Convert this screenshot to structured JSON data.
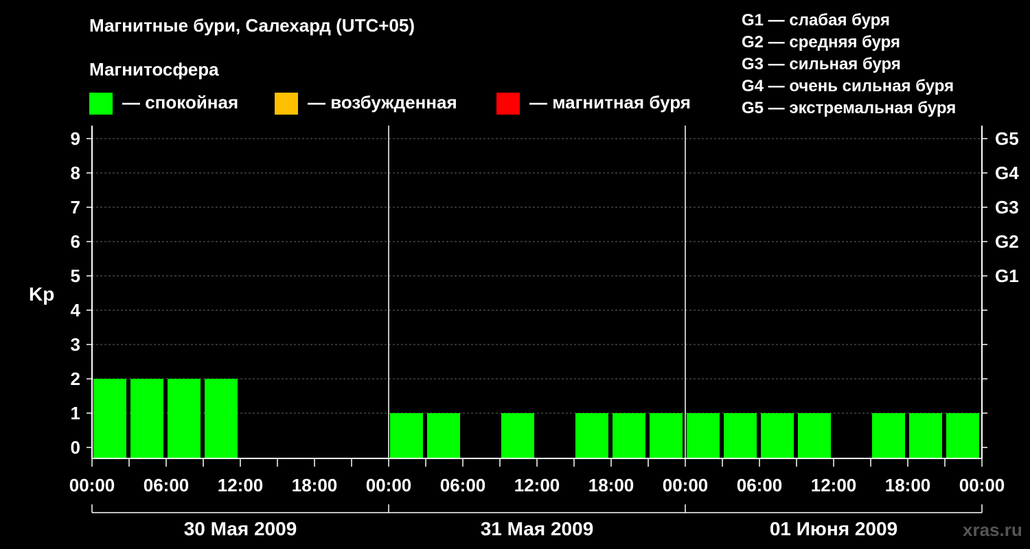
{
  "header": {
    "title": "Магнитные бури, Салехард (UTC+05)",
    "subtitle": "Магнитосфера"
  },
  "legend": [
    {
      "label": "— спокойная",
      "color": "#00ff00"
    },
    {
      "label": "— возбужденная",
      "color": "#ffc000"
    },
    {
      "label": "— магнитная буря",
      "color": "#ff0000"
    }
  ],
  "storm_scale": [
    "G1 — слабая буря",
    "G2 — средняя буря",
    "G3 — сильная буря",
    "G4 — очень сильная буря",
    "G5 — экстремальная буря"
  ],
  "watermark": "xras.ru",
  "chart_data": {
    "type": "bar",
    "ylabel": "Kp",
    "ylim": [
      0,
      9
    ],
    "y_ticks": [
      "0",
      "1",
      "2",
      "3",
      "4",
      "5",
      "6",
      "7",
      "8",
      "9"
    ],
    "right_axis_labels": [
      {
        "value": 5,
        "label": "G1"
      },
      {
        "value": 6,
        "label": "G2"
      },
      {
        "value": 7,
        "label": "G3"
      },
      {
        "value": 8,
        "label": "G4"
      },
      {
        "value": 9,
        "label": "G5"
      }
    ],
    "x_tick_labels": [
      "00:00",
      "06:00",
      "12:00",
      "18:00",
      "00:00",
      "06:00",
      "12:00",
      "18:00",
      "00:00",
      "06:00",
      "12:00",
      "18:00",
      "00:00"
    ],
    "days": [
      "30 Мая 2009",
      "31 Мая 2009",
      "01 Июня 2009"
    ],
    "interval_hours": 3,
    "categories": [
      "30.05 00:00",
      "30.05 03:00",
      "30.05 06:00",
      "30.05 09:00",
      "30.05 12:00",
      "30.05 15:00",
      "30.05 18:00",
      "30.05 21:00",
      "31.05 00:00",
      "31.05 03:00",
      "31.05 06:00",
      "31.05 09:00",
      "31.05 12:00",
      "31.05 15:00",
      "31.05 18:00",
      "31.05 21:00",
      "01.06 00:00",
      "01.06 03:00",
      "01.06 06:00",
      "01.06 09:00",
      "01.06 12:00",
      "01.06 15:00",
      "01.06 18:00",
      "01.06 21:00"
    ],
    "values": [
      2,
      2,
      2,
      2,
      0,
      0,
      0,
      0,
      1,
      1,
      0,
      1,
      0,
      1,
      1,
      1,
      1,
      1,
      1,
      1,
      0,
      1,
      1,
      1
    ],
    "bar_color": "#00ff00",
    "grid": true
  }
}
